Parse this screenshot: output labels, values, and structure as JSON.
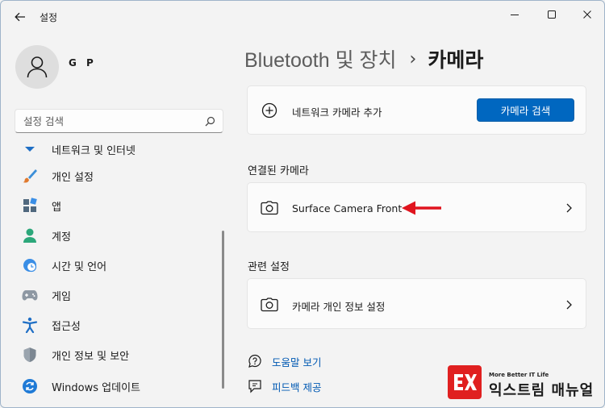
{
  "titlebar": {
    "app_title": "설정"
  },
  "user": {
    "name": "G P"
  },
  "search": {
    "placeholder": "설정 검색"
  },
  "sidebar": {
    "items": [
      {
        "label": "네트워크 및 인터넷",
        "icon": "network-icon"
      },
      {
        "label": "개인 설정",
        "icon": "brush-icon"
      },
      {
        "label": "앱",
        "icon": "apps-icon"
      },
      {
        "label": "계정",
        "icon": "person-icon"
      },
      {
        "label": "시간 및 언어",
        "icon": "clock-globe-icon"
      },
      {
        "label": "게임",
        "icon": "gamepad-icon"
      },
      {
        "label": "접근성",
        "icon": "accessibility-icon"
      },
      {
        "label": "개인 정보 및 보안",
        "icon": "shield-icon"
      },
      {
        "label": "Windows 업데이트",
        "icon": "update-icon"
      }
    ]
  },
  "breadcrumb": {
    "parent": "Bluetooth 및 장치",
    "separator": "›",
    "current": "카메라"
  },
  "add_card": {
    "label": "네트워크 카메라 추가",
    "button": "카메라 검색"
  },
  "connected": {
    "title": "연결된 카메라",
    "camera_name": "Surface Camera Front"
  },
  "related": {
    "title": "관련 설정",
    "privacy_label": "카메라 개인 정보 설정"
  },
  "links": {
    "help": "도움말 보기",
    "feedback": "피드백 제공"
  },
  "watermark": {
    "tagline": "More Better IT Life",
    "name": "익스트림 매뉴얼"
  },
  "colors": {
    "accent": "#0067c0",
    "arrow": "#e0141e",
    "link": "#0059b3"
  }
}
